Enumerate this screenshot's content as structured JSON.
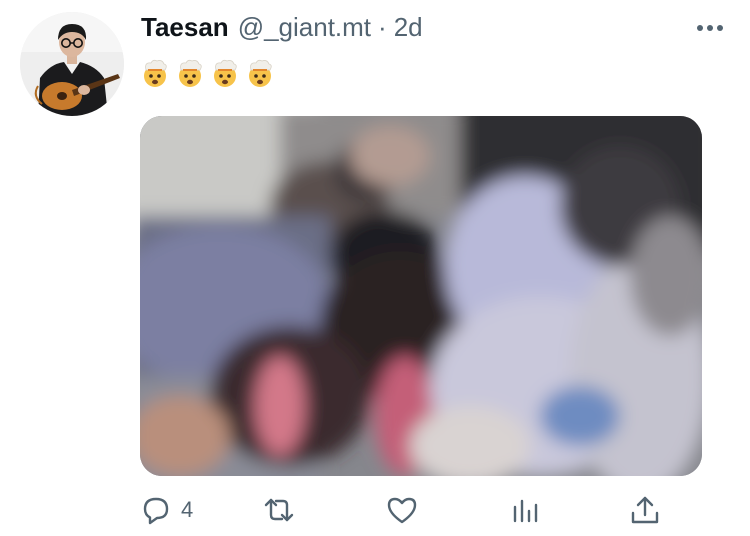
{
  "tweet": {
    "display_name": "Taesan",
    "handle": "@_giant.mt",
    "separator": "·",
    "time_ago": "2d",
    "text_emojis": [
      "exploding-head-emoji",
      "exploding-head-emoji",
      "exploding-head-emoji",
      "exploding-head-emoji"
    ],
    "media": {
      "kind": "blurred-photo"
    }
  },
  "actions": {
    "reply_count": "4",
    "retweet_count": "",
    "like_count": ""
  },
  "colors": {
    "text_primary": "#0f1419",
    "text_secondary": "#536471",
    "icon": "#536471"
  },
  "icons": [
    "more-icon",
    "reply-icon",
    "retweet-icon",
    "like-icon",
    "analytics-icon",
    "share-icon"
  ]
}
